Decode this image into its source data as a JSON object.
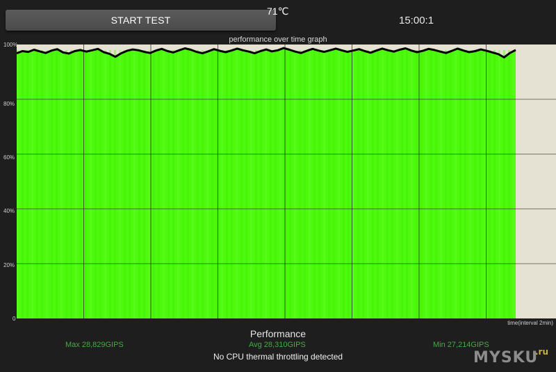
{
  "header": {
    "start_button_label": "START TEST",
    "temperature": "71℃",
    "timer": "15:00:1"
  },
  "graph": {
    "title": "performance over time graph",
    "y_ticks": [
      "100%",
      "80%",
      "60%",
      "40%",
      "20%",
      "0"
    ],
    "x_axis_label": "time(interval 2min)",
    "colors": {
      "fill": "#4dfa0c",
      "background": "#e6e2d3",
      "line": "#000000",
      "grid": "#1a1a1a"
    }
  },
  "chart_data": {
    "type": "area",
    "title": "performance over time graph",
    "xlabel": "time(interval 2min)",
    "ylabel": "",
    "ylim": [
      0,
      100
    ],
    "x_interval_minutes": 2,
    "y_ticks": [
      0,
      20,
      40,
      60,
      80,
      100
    ],
    "grid": true,
    "series": [
      {
        "values": [
          96.8,
          97.6,
          97.3,
          98.1,
          97.5,
          96.9,
          97.8,
          98.3,
          97.1,
          96.7,
          97.6,
          98.0,
          97.4,
          97.9,
          98.4,
          97.2,
          96.6,
          95.5,
          96.8,
          97.7,
          98.2,
          97.9,
          97.3,
          96.9,
          97.8,
          98.4,
          97.6,
          97.1,
          97.9,
          98.6,
          98.1,
          97.3,
          96.8,
          97.5,
          98.3,
          97.7,
          97.2,
          97.8,
          98.5,
          97.9,
          97.4,
          96.8,
          97.6,
          98.2,
          97.5,
          97.9,
          98.7,
          98.1,
          97.4,
          96.9,
          97.7,
          98.4,
          97.8,
          97.3,
          97.9,
          98.5,
          97.9,
          97.3,
          97.8,
          98.3,
          97.6,
          97.0,
          97.8,
          98.5,
          97.9,
          97.4,
          98.1,
          98.6,
          97.8,
          97.2,
          97.7,
          98.4,
          98.0,
          97.4,
          96.9,
          97.7,
          98.5,
          97.8,
          97.2,
          97.6,
          98.2,
          97.7,
          97.1,
          96.5,
          95.3,
          96.9,
          98.0
        ]
      }
    ]
  },
  "performance": {
    "title": "Performance",
    "max": "Max 28,829GIPS",
    "avg": "Avg 28,310GIPS",
    "min": "Min 27,214GIPS",
    "status": "No CPU thermal throttling detected"
  },
  "watermark": {
    "text": "MYSKU",
    "suffix": ".ru"
  }
}
